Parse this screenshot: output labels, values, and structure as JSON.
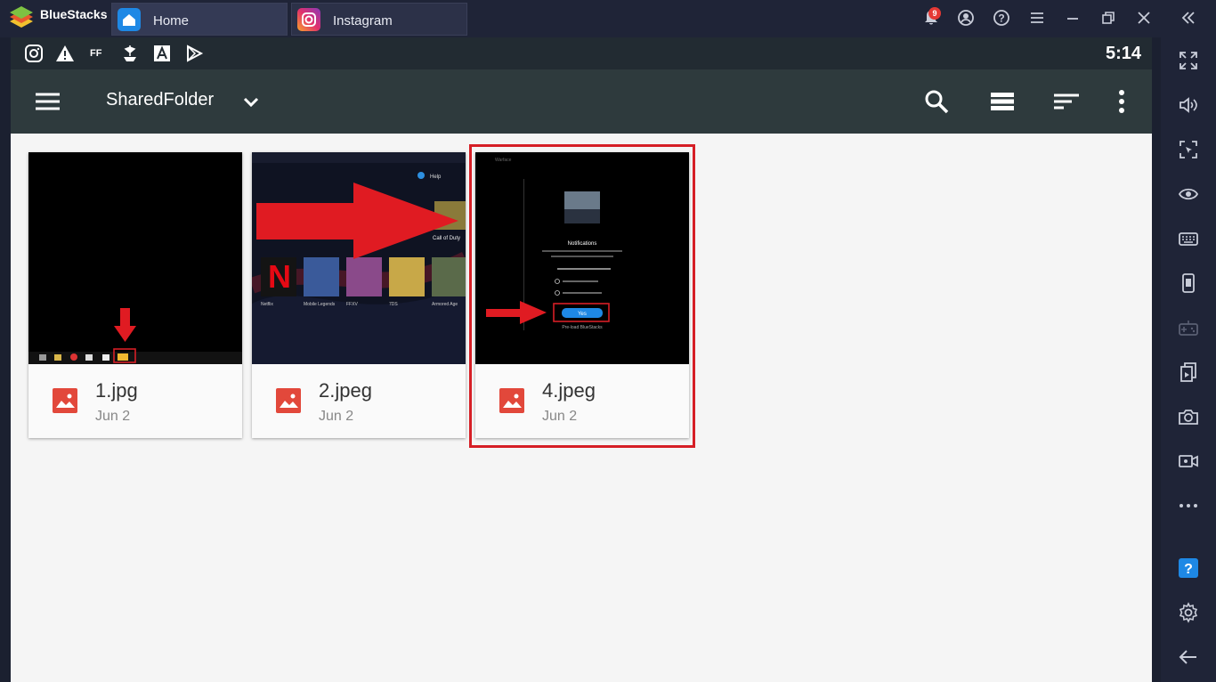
{
  "titlebar": {
    "brand": "BlueStacks",
    "tabs": [
      {
        "label": "Home",
        "icon": "home-icon"
      },
      {
        "label": "Instagram",
        "icon": "instagram-icon"
      }
    ],
    "notification_count": "9",
    "icons": [
      "bell-icon",
      "account-icon",
      "help-icon",
      "menu-icon",
      "minimize-icon",
      "restore-icon",
      "close-icon",
      "collapse-icon"
    ]
  },
  "statusbar": {
    "time": "5:14",
    "icons": [
      "instagram-icon",
      "warning-icon",
      "ff-icon",
      "ship-icon",
      "a-icon",
      "play-store-icon"
    ],
    "ff_label": "FF"
  },
  "appbar": {
    "folder_title": "SharedFolder",
    "icons": [
      "hamburger-icon",
      "dropdown-icon",
      "search-icon",
      "list-view-icon",
      "sort-icon",
      "more-vert-icon"
    ]
  },
  "files": [
    {
      "name": "1.jpg",
      "date": "Jun 2"
    },
    {
      "name": "2.jpeg",
      "date": "Jun 2"
    },
    {
      "name": "4.jpeg",
      "date": "Jun 2"
    }
  ],
  "thumb2": {
    "help": "Help",
    "game_label": "Call of Duty",
    "netflix_letter": "N",
    "tiles": [
      "Netflix",
      "Mobile Legends",
      "FFXV",
      "7DS",
      "Armored Age"
    ]
  },
  "thumb4": {
    "window_title": "Warface",
    "dialog_title": "Notifications",
    "button_label": "Yes",
    "footer": "Pre-load BlueStacks"
  },
  "sidebar": {
    "icons": [
      "fullscreen-icon",
      "volume-icon",
      "cursor-icon",
      "eye-icon",
      "keyboard-icon",
      "phone-icon",
      "gamepad-icon",
      "multi-instance-icon",
      "camera-icon",
      "video-icon",
      "more-icon",
      "help-icon",
      "settings-icon",
      "back-icon"
    ]
  },
  "colors": {
    "titlebar": "#1f2437",
    "appbar": "#2e3a3d",
    "statusbar": "#222b32",
    "highlight": "#d61f26",
    "file_icon": "#e2483b"
  }
}
